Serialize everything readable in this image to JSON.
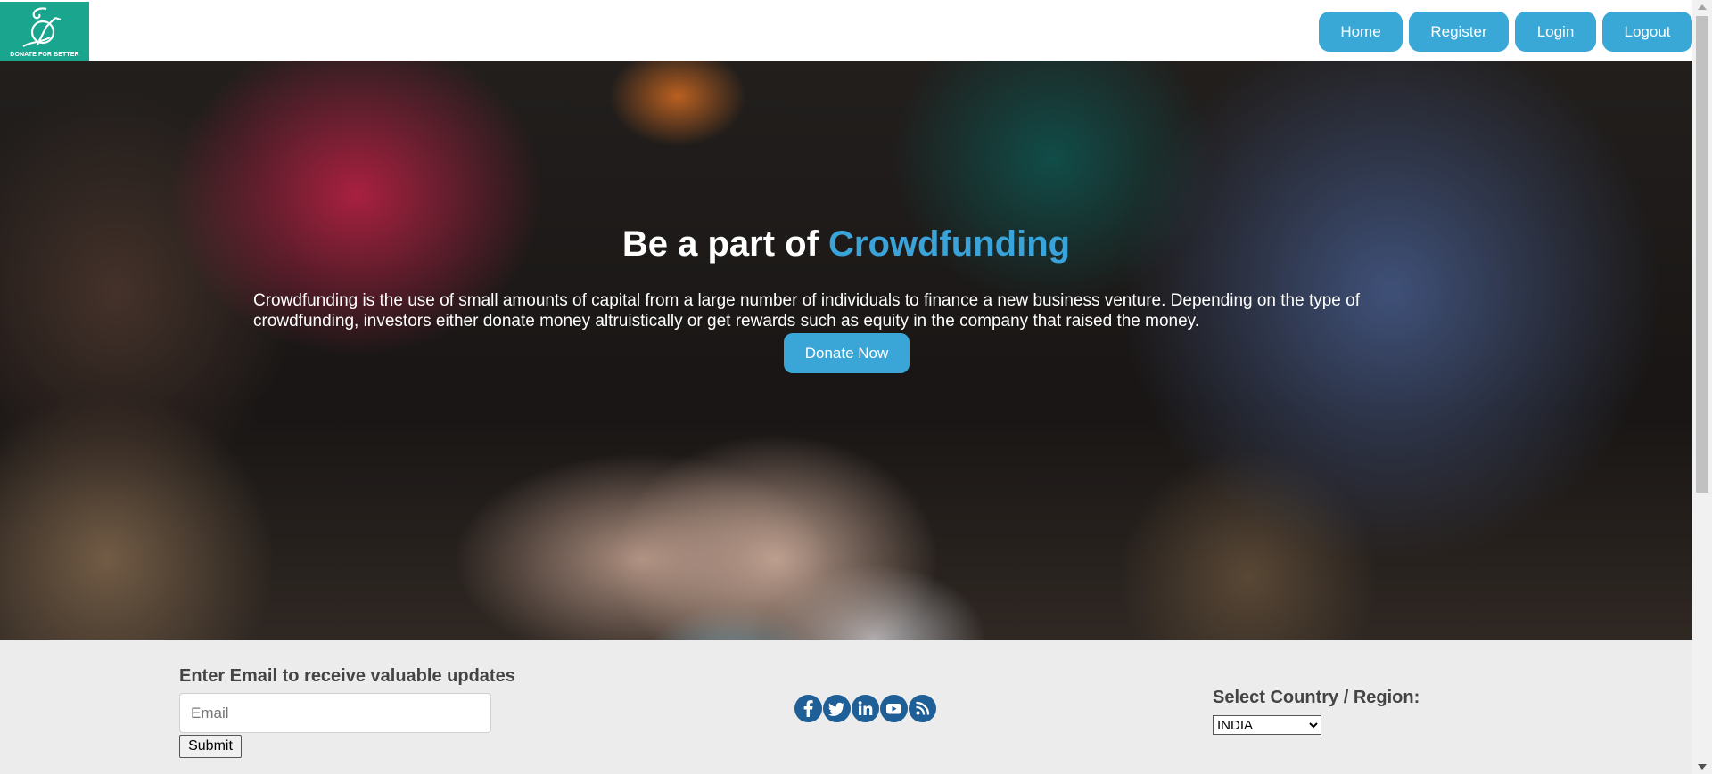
{
  "logo": {
    "text": "DONATE FOR BETTER",
    "bg_color": "#1aa58f"
  },
  "nav": {
    "home": "Home",
    "register": "Register",
    "login": "Login",
    "logout": "Logout",
    "color": "#39a8d6"
  },
  "hero": {
    "title_prefix": "Be a part of ",
    "title_accent": "Crowdfunding",
    "accent_color": "#3aa3d9",
    "description": "Crowdfunding is the use of small amounts of capital from a large number of individuals to finance a new business venture. Depending on the type of crowdfunding, investors either donate money altruistically or get rewards such as equity in the company that raised the money.",
    "donate_button": "Donate Now"
  },
  "footer": {
    "email_heading": "Enter Email to receive valuable updates",
    "email_placeholder": "Email",
    "email_value": "",
    "submit_label": "Submit",
    "social_icons": [
      "facebook-icon",
      "twitter-icon",
      "linkedin-icon",
      "youtube-icon",
      "rss-icon"
    ],
    "social_color": "#1d5f96",
    "country_label": "Select Country / Region:",
    "country_selected": "INDIA"
  }
}
